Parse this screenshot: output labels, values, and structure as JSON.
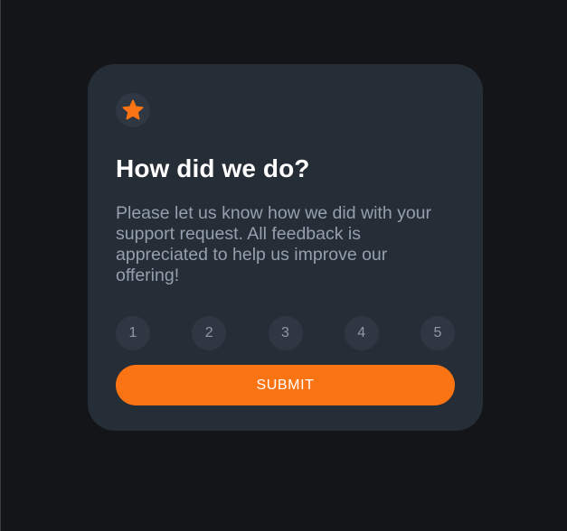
{
  "card": {
    "icon": "star-icon",
    "title": "How did we do?",
    "description": "Please let us know how we did with your support request. All feedback is appreciated to help us improve our offering!",
    "ratings": [
      "1",
      "2",
      "3",
      "4",
      "5"
    ],
    "submit_label": "SUBMIT"
  },
  "colors": {
    "page_background": "#131518",
    "card_background": "#252d37",
    "circle_background": "#2f3742",
    "accent": "#fb7413",
    "title_text": "#ffffff",
    "body_text": "#969fad"
  }
}
